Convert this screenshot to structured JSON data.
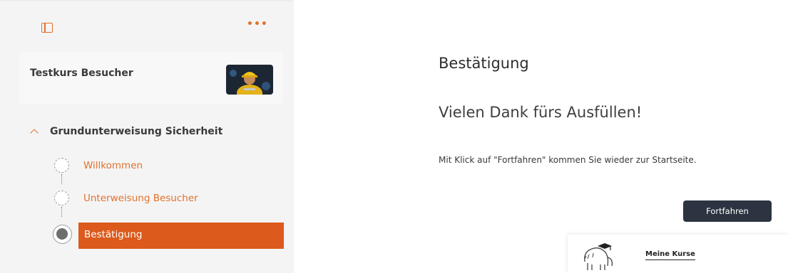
{
  "sidebar": {
    "course_title": "Testkurs Besucher",
    "section_title": "Grundunterweisung Sicherheit",
    "steps": [
      {
        "label": "Willkommen"
      },
      {
        "label": "Unterweisung Besucher"
      },
      {
        "label": "Bestätigung"
      }
    ]
  },
  "main": {
    "title": "Bestätigung",
    "thanks": "Vielen Dank fürs Ausfüllen!",
    "info": "Mit Klick auf \"Fortfahren\" kommen Sie wieder zur Startseite.",
    "continue_label": "Fortfahren"
  },
  "footer": {
    "link_label": "Meine Kurse"
  },
  "icons": [
    "sidebar-toggle-icon",
    "more-options-icon",
    "chevron-up-icon",
    "mammoth-logo-icon"
  ],
  "colors": {
    "accent": "#e2712d",
    "active": "#dc5a1b",
    "button": "#2b3440"
  }
}
